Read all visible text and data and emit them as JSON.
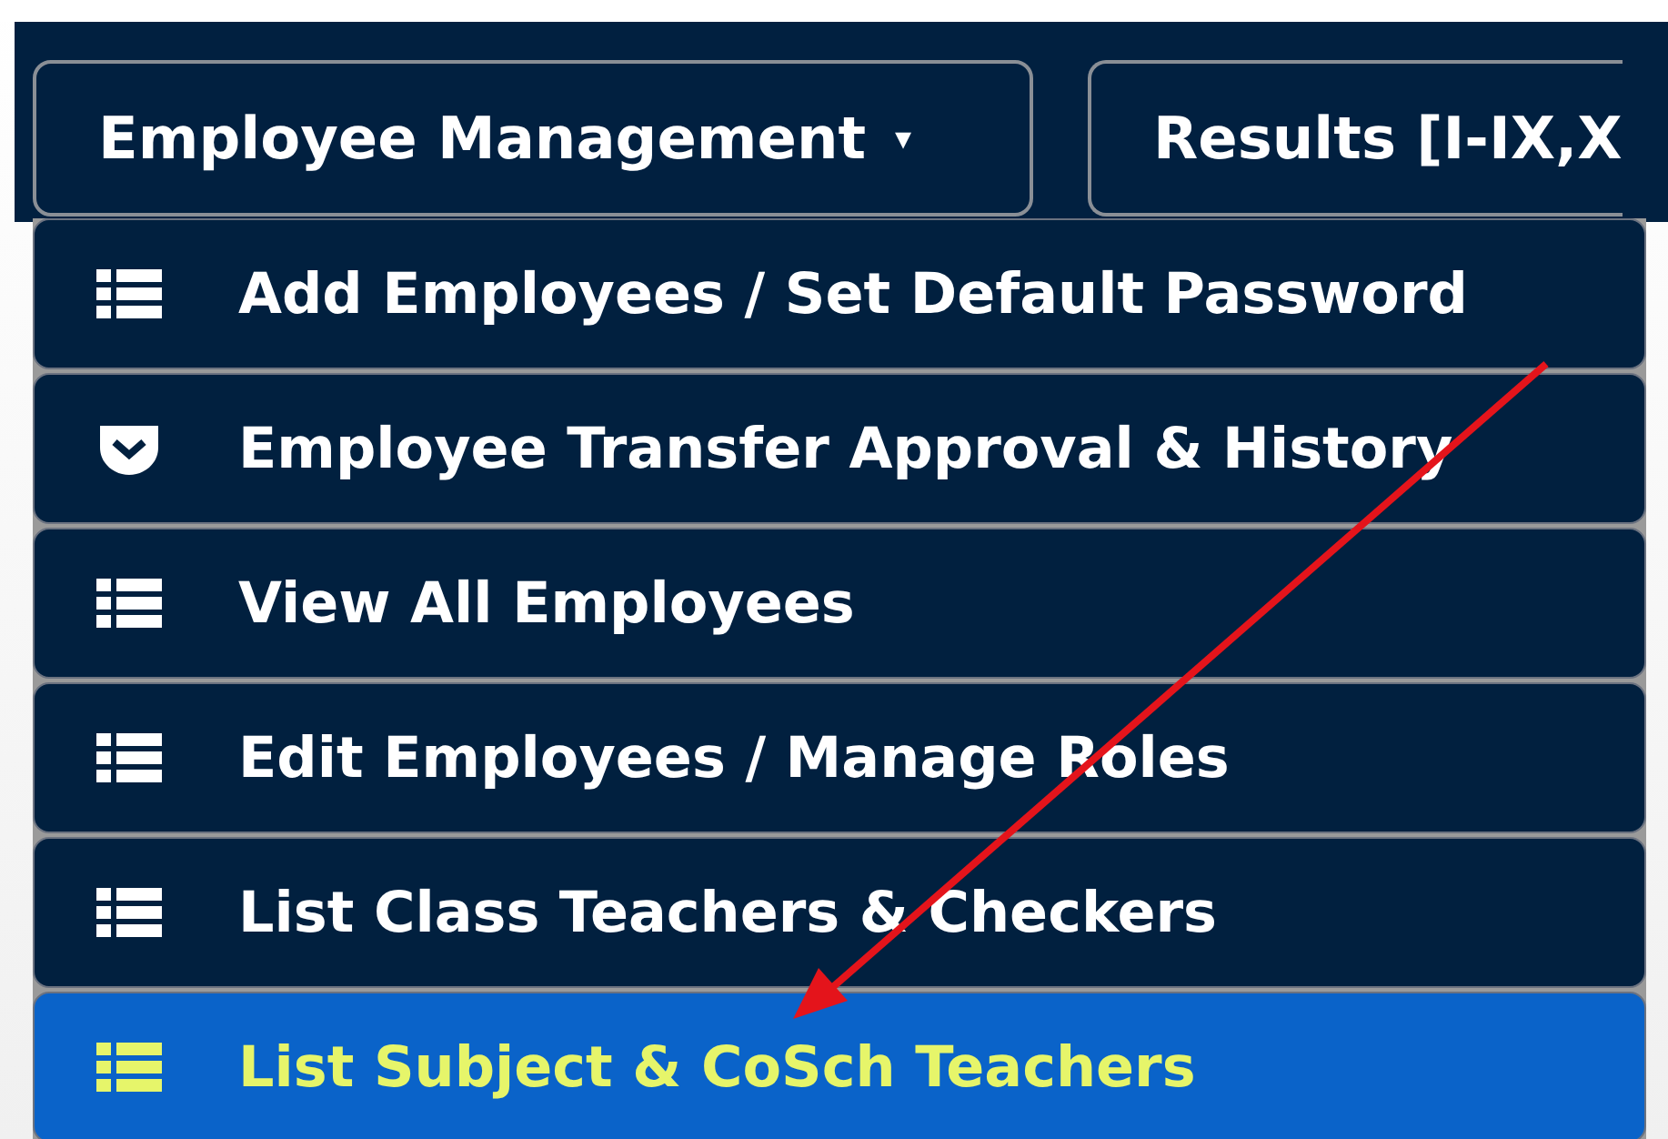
{
  "navbar": {
    "menus": [
      {
        "label": "Employee Management",
        "caret": "▾"
      },
      {
        "label": "Results [I-IX,X"
      }
    ]
  },
  "dropdown": {
    "items": [
      {
        "label": "Add Employees / Set Default Password",
        "kind": "list",
        "selected": false
      },
      {
        "label": "Employee Transfer Approval & History",
        "kind": "shield",
        "selected": false
      },
      {
        "label": "View All Employees",
        "kind": "list",
        "selected": false
      },
      {
        "label": "Edit Employees / Manage Roles",
        "kind": "list",
        "selected": false
      },
      {
        "label": "List Class Teachers & Checkers",
        "kind": "list",
        "selected": false
      },
      {
        "label": "List Subject & CoSch Teachers",
        "kind": "list",
        "selected": true
      }
    ]
  }
}
